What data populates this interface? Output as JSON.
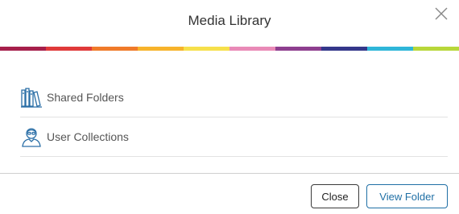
{
  "dialog": {
    "title": "Media Library",
    "close_icon": "close-icon"
  },
  "rainbow_colors": [
    "#a61f4b",
    "#e03a3a",
    "#f07a2a",
    "#f7b32b",
    "#f6e04b",
    "#e98ab7",
    "#8e3f8f",
    "#34378a",
    "#2fb6d9",
    "#b8d73a"
  ],
  "items": [
    {
      "label": "Shared Folders",
      "icon": "bookshelf-icon"
    },
    {
      "label": "User Collections",
      "icon": "user-icon"
    }
  ],
  "buttons": {
    "close_label": "Close",
    "view_label": "View Folder"
  },
  "colors": {
    "accent": "#1f6fa5",
    "icon": "#2a6ea6"
  }
}
